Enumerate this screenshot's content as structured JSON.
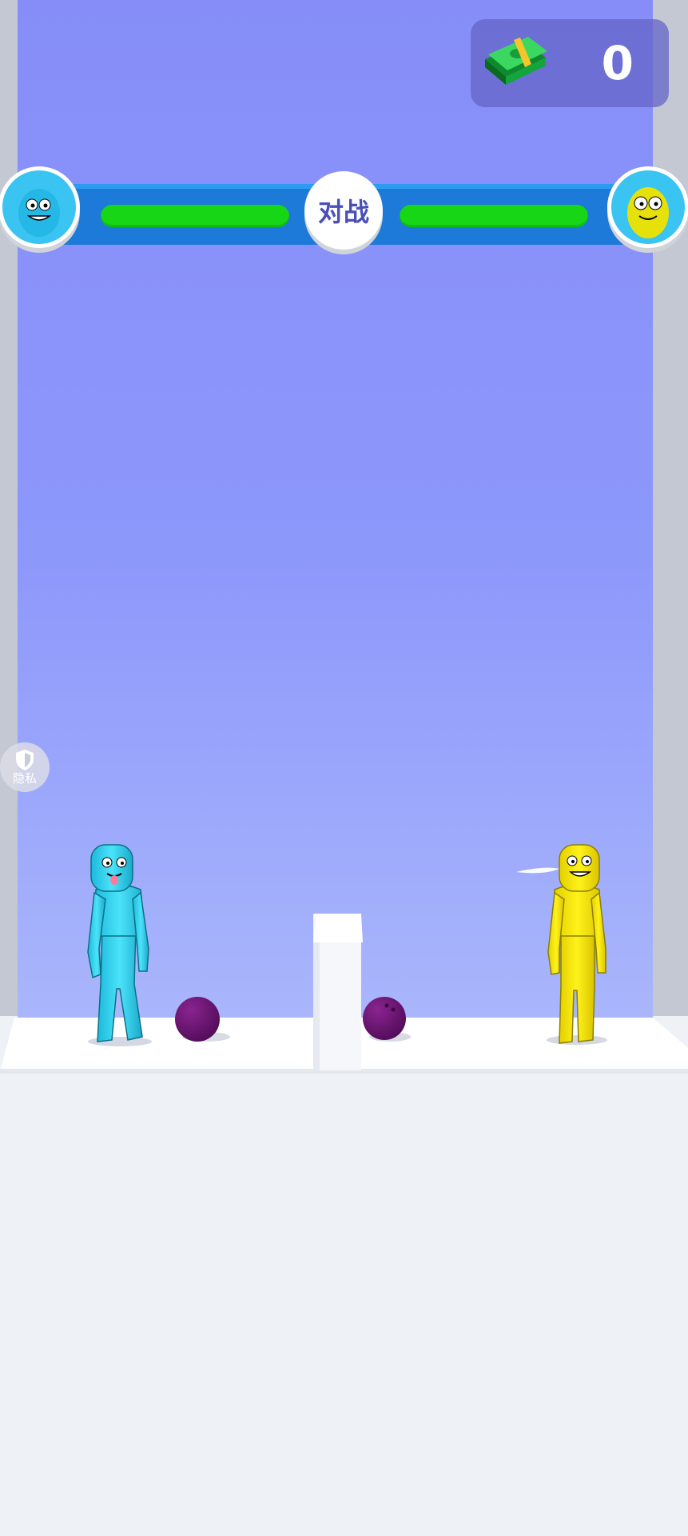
{
  "hud": {
    "money_value": "0",
    "cash_icon": "cash-stack-icon",
    "versus_label": "对战",
    "player_avatar": "blue-character-avatar",
    "enemy_avatar": "yellow-character-avatar",
    "player_health_fraction": 1.0,
    "enemy_health_fraction": 1.0
  },
  "privacy": {
    "label": "隐私",
    "icon": "shield-icon"
  },
  "colors": {
    "sky": "#8a92fc",
    "floor": "#eef2f6",
    "health": "#16d616",
    "bar": "#1d7ad8",
    "player": "#3ad6f2",
    "enemy": "#f5ea10",
    "ball": "#6a1170"
  }
}
